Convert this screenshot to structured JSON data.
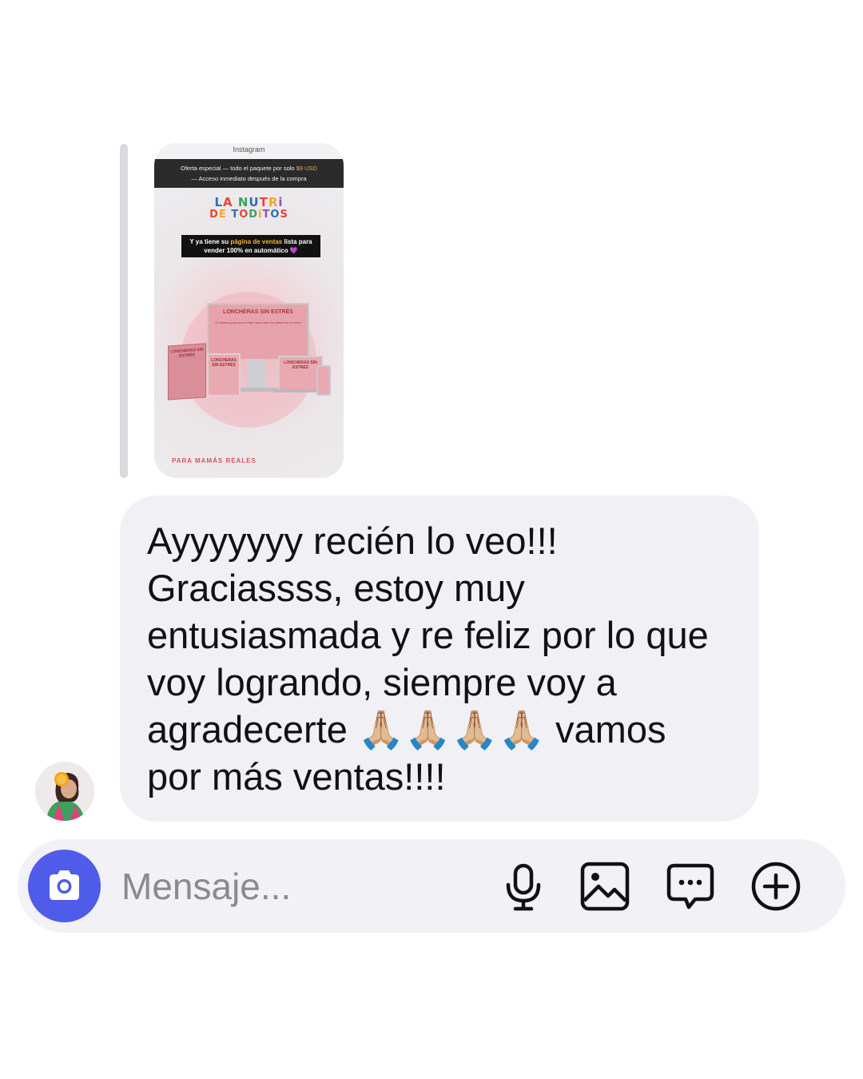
{
  "story": {
    "app_label": "Instagram",
    "banner_line1_prefix": "Oferta especial — todo el paquete por solo",
    "banner_price": "$9 USD",
    "banner_line2": "— Acceso inmediato después de la compra",
    "logo_line1": "LA NUTRi",
    "logo_line2": "DE TODiTOS",
    "promo_prefix": "Y ya tiene su",
    "promo_highlight": "página de ventas",
    "promo_suffix": "lista para vender 100% en automático",
    "promo_emoji": "💜",
    "product_title": "LONCHERAS SIN ESTRÉS",
    "product_subtitle": "El sistema para que tu hija coma sano sin pelear en la mesa",
    "footer_tag": "PARA MAMÁS REALES"
  },
  "message": {
    "text": "Ayyyyyyy recién lo veo!!! Graciassss, estoy muy entusiasmada y re feliz por lo que voy logrando, siempre voy a agradecerte 🙏🏼🙏🏼🙏🏼🙏🏼 vamos por más ventas!!!!"
  },
  "composer": {
    "placeholder": "Mensaje...",
    "accent_color": "#4f5be9"
  },
  "icons": {
    "camera": "camera-icon",
    "microphone": "microphone-icon",
    "gallery": "gallery-icon",
    "sticker": "chat-bubble-icon",
    "add": "plus-circle-icon"
  }
}
